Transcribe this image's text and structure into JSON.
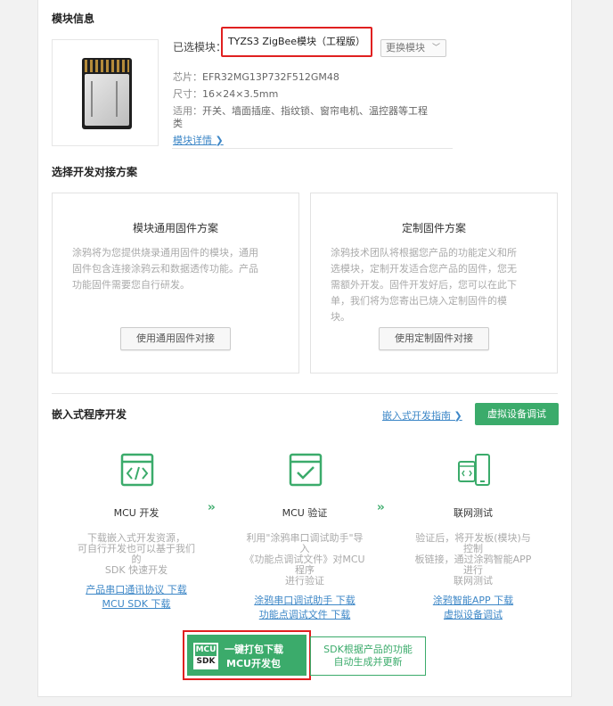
{
  "module": {
    "section_title": "模块信息",
    "selected_label": "已选模块：",
    "selected_name": "TYZS3 ZigBee模块（工程版）",
    "swap_button": "更换模块",
    "chip_label": "芯片：",
    "chip_value": "EFR32MG13P732F512GM48",
    "size_label": "尺寸：",
    "size_value": "16×24×3.5mm",
    "apply_label": "适用：",
    "apply_value_1": "开关、墙面插座、指纹锁、窗帘电机、温控器等工程",
    "apply_value_2": "类",
    "detail_link": "模块详情 ❯"
  },
  "plan": {
    "section_title": "选择开发对接方案",
    "cards": [
      {
        "title": "模块通用固件方案",
        "desc": [
          "涂鸦将为您提供烧录通用固件的模块，通用",
          "固件包含连接涂鸦云和数据透传功能。产品",
          "功能固件需要您自行研发。"
        ],
        "button": "使用通用固件对接"
      },
      {
        "title": "定制固件方案",
        "desc": [
          "涂鸦技术团队将根据您产品的功能定义和所",
          "选模块，定制开发适合您产品的固件，您无",
          "需额外开发。固件开发好后，您可以在此下",
          "单，我们将为您寄出已烧入定制固件的模",
          "块。"
        ],
        "button": "使用定制固件对接"
      }
    ]
  },
  "embedded": {
    "section_title": "嵌入式程序开发",
    "guide_link": "嵌入式开发指南 ❯",
    "virtual_button": "虚拟设备调试",
    "arrow_glyph": "››",
    "steps": [
      {
        "label": "MCU 开发",
        "desc": [
          "下载嵌入式开发资源，",
          "可自行开发也可以基于我们",
          "的",
          "SDK 快速开发"
        ],
        "links": [
          "产品串口通讯协议 下载",
          "MCU SDK 下载"
        ]
      },
      {
        "label": "MCU 验证",
        "desc": [
          "利用\"涂鸦串口调试助手\"导",
          "入",
          "《功能点调试文件》对MCU",
          "程序",
          "进行验证"
        ],
        "links": [
          "涂鸦串口调试助手 下载",
          "功能点调试文件 下载"
        ]
      },
      {
        "label": "联网测试",
        "desc": [
          "验证后，将开发板(模块)与",
          "控制",
          "板链接，通过涂鸦智能APP",
          "进行",
          "联网测试"
        ],
        "links": [
          "涂鸦智能APP 下载",
          "虚拟设备调试"
        ]
      }
    ],
    "pack_icon_top": "MCU",
    "pack_icon_bottom": "SDK",
    "pack_line1": "一键打包下载",
    "pack_line2": "MCU开发包",
    "auto_line1": "SDK根据产品的功能",
    "auto_line2": "自动生成并更新"
  },
  "colors": {
    "accent_green": "#3bab6b",
    "highlight_red": "#e02020",
    "link_blue": "#3d87c7"
  }
}
